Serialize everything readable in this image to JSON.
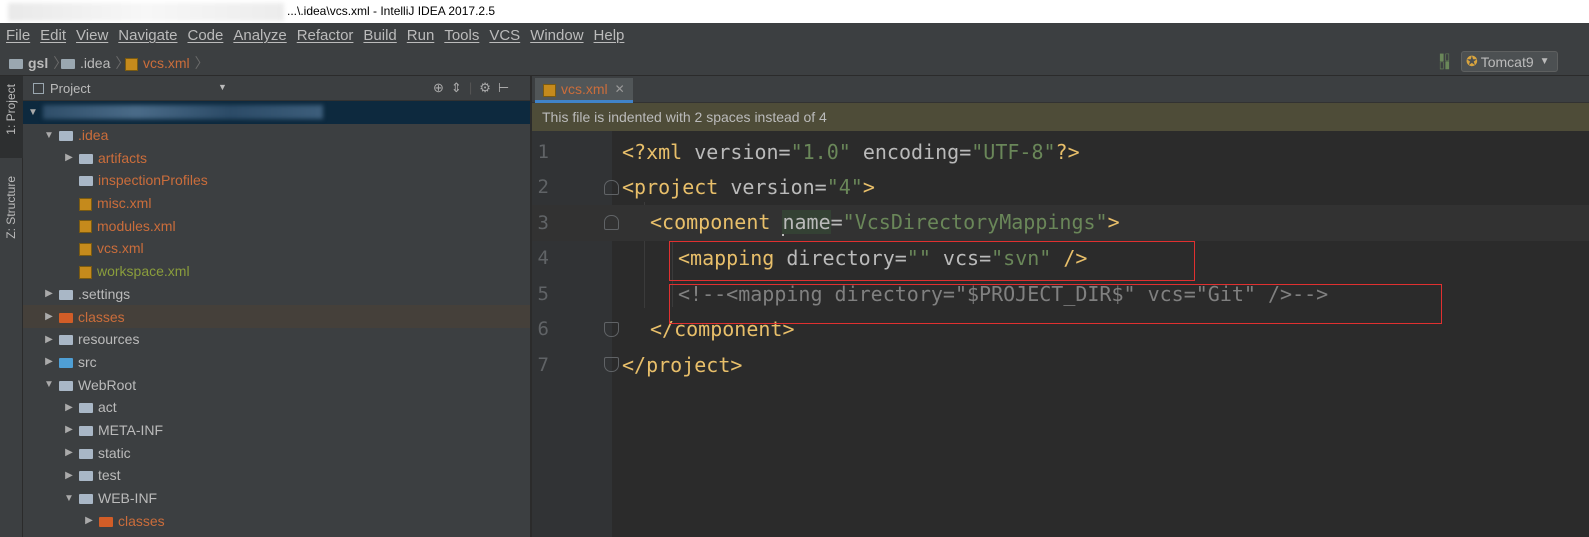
{
  "window": {
    "title": "...\\.idea\\vcs.xml - IntelliJ IDEA 2017.2.5"
  },
  "menu": [
    "File",
    "Edit",
    "View",
    "Navigate",
    "Code",
    "Analyze",
    "Refactor",
    "Build",
    "Run",
    "Tools",
    "VCS",
    "Window",
    "Help"
  ],
  "breadcrumb": [
    "gsl",
    ".idea",
    "vcs.xml"
  ],
  "run_config": "Tomcat9",
  "tool_windows": {
    "project": "1: Project",
    "structure": "Z: Structure"
  },
  "project_panel": {
    "title": "Project"
  },
  "tree": [
    {
      "label": ".idea",
      "color": "red"
    },
    {
      "label": "artifacts",
      "color": "red"
    },
    {
      "label": "inspectionProfiles",
      "color": "red"
    },
    {
      "label": "misc.xml",
      "color": "red"
    },
    {
      "label": "modules.xml",
      "color": "red"
    },
    {
      "label": "vcs.xml",
      "color": "red"
    },
    {
      "label": "workspace.xml",
      "color": "green"
    },
    {
      "label": ".settings",
      "color": "default"
    },
    {
      "label": "classes",
      "color": "red"
    },
    {
      "label": "resources",
      "color": "default"
    },
    {
      "label": "src",
      "color": "default"
    },
    {
      "label": "WebRoot",
      "color": "default"
    },
    {
      "label": "act",
      "color": "default"
    },
    {
      "label": "META-INF",
      "color": "default"
    },
    {
      "label": "static",
      "color": "default"
    },
    {
      "label": "test",
      "color": "default"
    },
    {
      "label": "WEB-INF",
      "color": "default"
    },
    {
      "label": "classes",
      "color": "red"
    }
  ],
  "editor": {
    "tab": "vcs.xml",
    "notice": "This file is indented with 2 spaces instead of 4",
    "lines": [
      "1",
      "2",
      "3",
      "4",
      "5",
      "6",
      "7"
    ],
    "code": {
      "l1": {
        "a": "<?xml ",
        "b": "version",
        "c": "=",
        "d": "\"1.0\"",
        "e": " encoding",
        "f": "=",
        "g": "\"UTF-8\"",
        "h": "?>"
      },
      "l2": {
        "a": "<project ",
        "b": "version",
        "c": "=",
        "d": "\"4\"",
        "e": ">"
      },
      "l3": {
        "a": "<component ",
        "b": "name",
        "c": "=",
        "d": "\"VcsDirectoryMappings\"",
        "e": ">"
      },
      "l4": {
        "a": "<mapping ",
        "b": "directory",
        "c": "=",
        "d": "\"\"",
        "e": " vcs",
        "f": "=",
        "g": "\"svn\"",
        "h": " />"
      },
      "l5": "<!--<mapping directory=\"$PROJECT_DIR$\" vcs=\"Git\" />-->",
      "l6": "</component>",
      "l7": "</project>"
    }
  },
  "colors": {
    "tag": "#e8bf6a",
    "attribute": "#bababa",
    "value": "#6a8759",
    "comment": "#808080",
    "highlight_box": "#e03030"
  }
}
